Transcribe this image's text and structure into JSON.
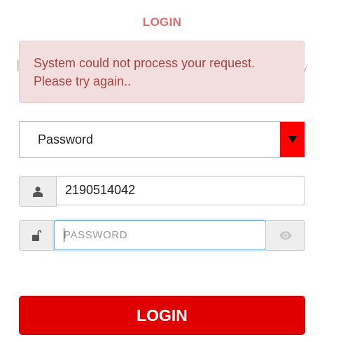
{
  "header": {
    "title": "LOGIN"
  },
  "alert": {
    "message": "System could not process your request. Please try again.."
  },
  "login_type": {
    "selected": "Password"
  },
  "username": {
    "value": "2190514042"
  },
  "password": {
    "placeholder": "PASSWORD"
  },
  "buttons": {
    "login": "LOGIN"
  },
  "icons": {
    "select_arrow": "dropdown-arrow-icon",
    "user": "user-icon",
    "lock": "unlock-icon",
    "eye": "eye-icon"
  },
  "colors": {
    "primary_red": "#e00000",
    "select_arrow_bg": "#ff0000",
    "title": "#e06b6f",
    "alert_bg": "#f2dede",
    "alert_text": "#a94442",
    "focus_border": "#66afe9"
  }
}
